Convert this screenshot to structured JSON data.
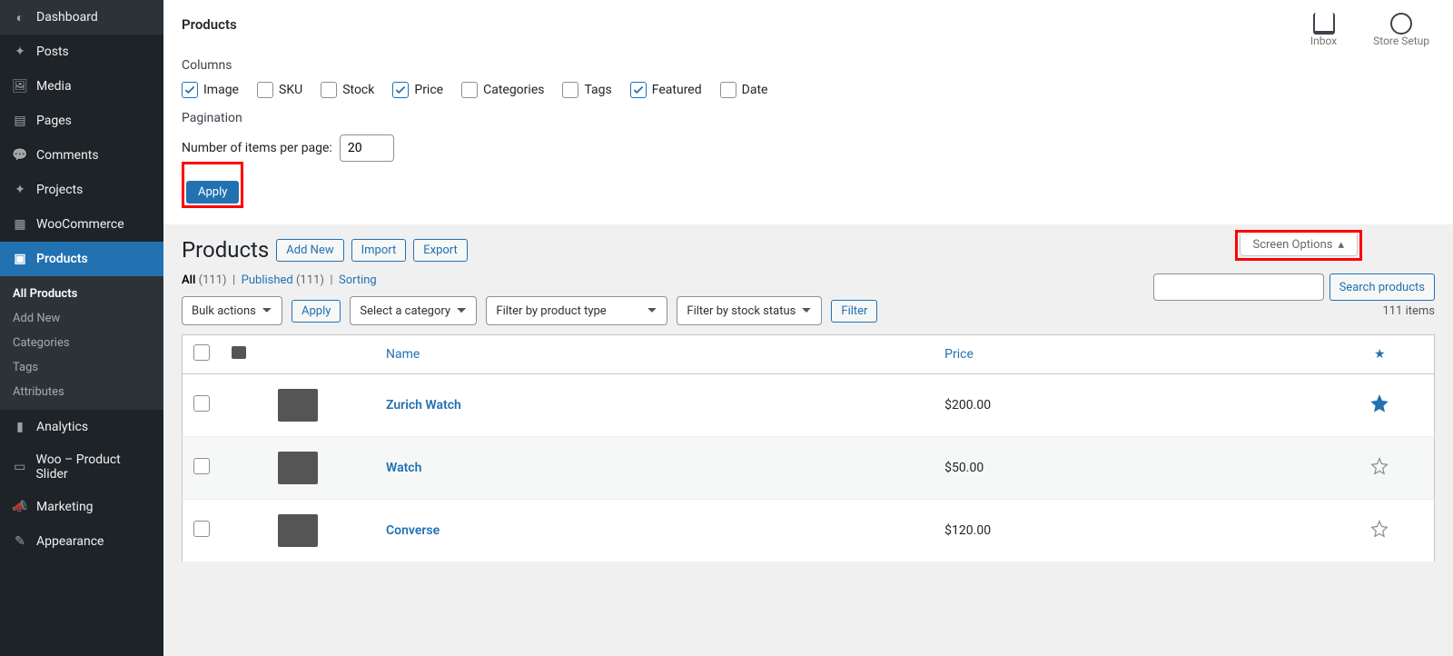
{
  "sidebar": {
    "items": [
      {
        "label": "Dashboard",
        "icon": "dashboard"
      },
      {
        "label": "Posts",
        "icon": "pin"
      },
      {
        "label": "Media",
        "icon": "media"
      },
      {
        "label": "Pages",
        "icon": "page"
      },
      {
        "label": "Comments",
        "icon": "comment"
      },
      {
        "label": "Projects",
        "icon": "pin"
      },
      {
        "label": "WooCommerce",
        "icon": "woo"
      },
      {
        "label": "Products",
        "icon": "archive",
        "active": true
      },
      {
        "label": "Analytics",
        "icon": "chart"
      },
      {
        "label": "Woo – Product Slider",
        "icon": "slider"
      },
      {
        "label": "Marketing",
        "icon": "megaphone"
      },
      {
        "label": "Appearance",
        "icon": "brush"
      }
    ],
    "submenu": [
      {
        "label": "All Products",
        "current": true
      },
      {
        "label": "Add New"
      },
      {
        "label": "Categories"
      },
      {
        "label": "Tags"
      },
      {
        "label": "Attributes"
      }
    ]
  },
  "topbar": {
    "title": "Products",
    "inbox": "Inbox",
    "setup": "Store Setup"
  },
  "screen_options": {
    "columns_label": "Columns",
    "columns": [
      {
        "label": "Image",
        "checked": true
      },
      {
        "label": "SKU",
        "checked": false
      },
      {
        "label": "Stock",
        "checked": false
      },
      {
        "label": "Price",
        "checked": true
      },
      {
        "label": "Categories",
        "checked": false
      },
      {
        "label": "Tags",
        "checked": false
      },
      {
        "label": "Featured",
        "checked": true
      },
      {
        "label": "Date",
        "checked": false
      }
    ],
    "pagination_label": "Pagination",
    "per_page_label": "Number of items per page:",
    "per_page_value": "20",
    "apply": "Apply",
    "toggle": "Screen Options"
  },
  "page": {
    "heading": "Products",
    "add_new": "Add New",
    "import": "Import",
    "export": "Export",
    "views": {
      "all_label": "All",
      "all_count": "(111)",
      "published_label": "Published",
      "published_count": "(111)",
      "sorting": "Sorting"
    },
    "search_btn": "Search products",
    "bulk_actions": "Bulk actions",
    "bulk_apply": "Apply",
    "filter_category": "Select a category",
    "filter_type": "Filter by product type",
    "filter_stock": "Filter by stock status",
    "filter_btn": "Filter",
    "item_count": "111 items"
  },
  "table": {
    "headers": {
      "name": "Name",
      "price": "Price"
    },
    "rows": [
      {
        "name": "Zurich Watch",
        "price": "$200.00",
        "featured": true
      },
      {
        "name": "Watch",
        "price": "$50.00",
        "featured": false
      },
      {
        "name": "Converse",
        "price": "$120.00",
        "featured": false
      }
    ]
  }
}
